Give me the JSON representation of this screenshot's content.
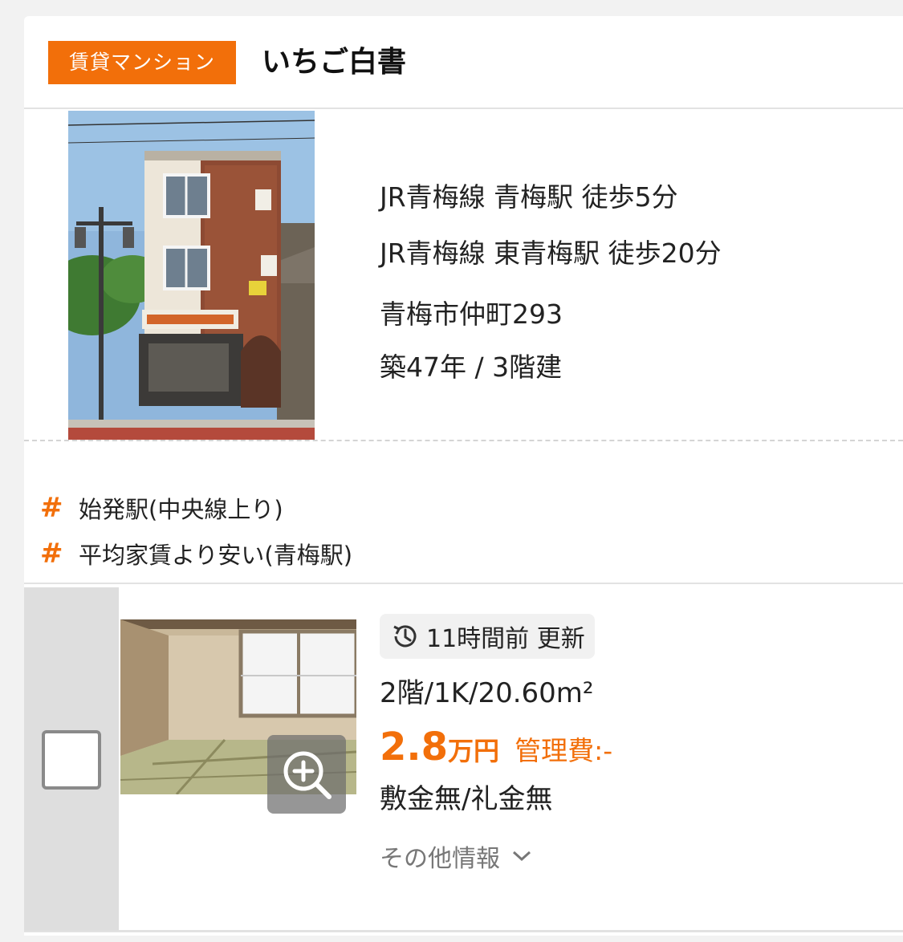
{
  "building": {
    "type_badge": "賃貸マンション",
    "name": "いちご白書",
    "access": [
      "JR青梅線 青梅駅 徒歩5分",
      "JR青梅線 東青梅駅 徒歩20分"
    ],
    "address": "青梅市仲町293",
    "age_floors": "築47年 / 3階建",
    "photo_icon": "building-photo"
  },
  "tags": [
    {
      "hash": "#",
      "label": "始発駅(中央線上り)"
    },
    {
      "hash": "#",
      "label": "平均家賃より安い(青梅駅)"
    }
  ],
  "room": {
    "updated": "11時間前 更新",
    "spec": "2階/1K/20.60m²",
    "price_value": "2.8",
    "price_unit": "万円",
    "management_fee": "管理費:-",
    "deposit_key": "敷金無/礼金無",
    "more_label": "その他情報",
    "photo_icon": "room-photo",
    "zoom_icon": "zoom-in-icon"
  },
  "colors": {
    "accent": "#f26f0a",
    "background": "#f2f2f2",
    "card": "#ffffff"
  }
}
